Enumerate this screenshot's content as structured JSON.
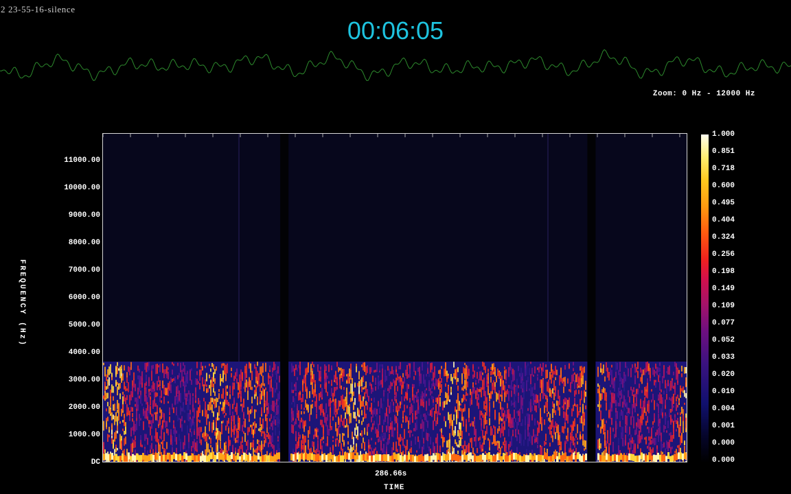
{
  "file_title": "2 23-55-16-silence",
  "playback_time": "00:06:05",
  "zoom_label": "Zoom: 0 Hz - 12000 Hz",
  "colors": {
    "time": "#1ec3df",
    "waveform": "#2d8a2d",
    "background": "#000000",
    "plot_bg": "#07071c"
  },
  "chart_data": {
    "type": "heatmap",
    "ylabel": "FREQUENCY (Hz)",
    "xlabel": "TIME",
    "x_tick_labels": [
      "286.66s"
    ],
    "y_tick_labels": [
      "11000.00",
      "10000.00",
      "9000.00",
      "8000.00",
      "7000.00",
      "6000.00",
      "5000.00",
      "4000.00",
      "3000.00",
      "2000.00",
      "1000.00",
      "DC"
    ],
    "ylim": [
      0,
      12000
    ],
    "signal_band_hz": [
      0,
      3700
    ],
    "colorbar_labels": [
      "1.000",
      "0.851",
      "0.718",
      "0.600",
      "0.495",
      "0.404",
      "0.324",
      "0.256",
      "0.198",
      "0.149",
      "0.109",
      "0.077",
      "0.052",
      "0.033",
      "0.020",
      "0.010",
      "0.004",
      "0.001",
      "0.000",
      "0.000"
    ],
    "silent_gaps": [
      0.31,
      0.835
    ]
  }
}
